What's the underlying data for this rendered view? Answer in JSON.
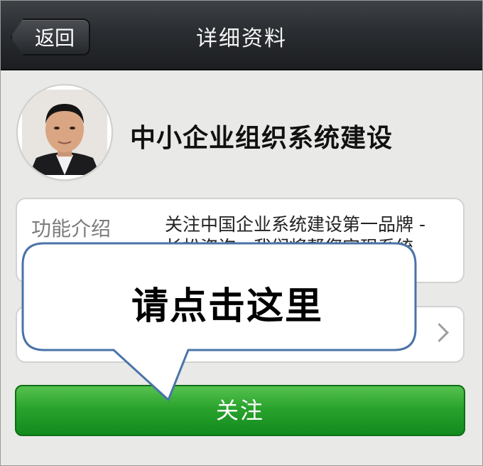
{
  "header": {
    "back_label": "返回",
    "title": "详细资料"
  },
  "profile": {
    "name": "中小企业组织系统建设"
  },
  "description": {
    "label": "功能介绍",
    "text": "关注中国企业系统建设第一品牌 - 长松咨询，我们将帮您实现系统"
  },
  "follow_button": {
    "label": "关注"
  },
  "callout": {
    "text": "请点击这里"
  },
  "colors": {
    "topbar": "#2a2d31",
    "follow_green": "#2aa32d",
    "callout_border": "#4a73a8"
  }
}
